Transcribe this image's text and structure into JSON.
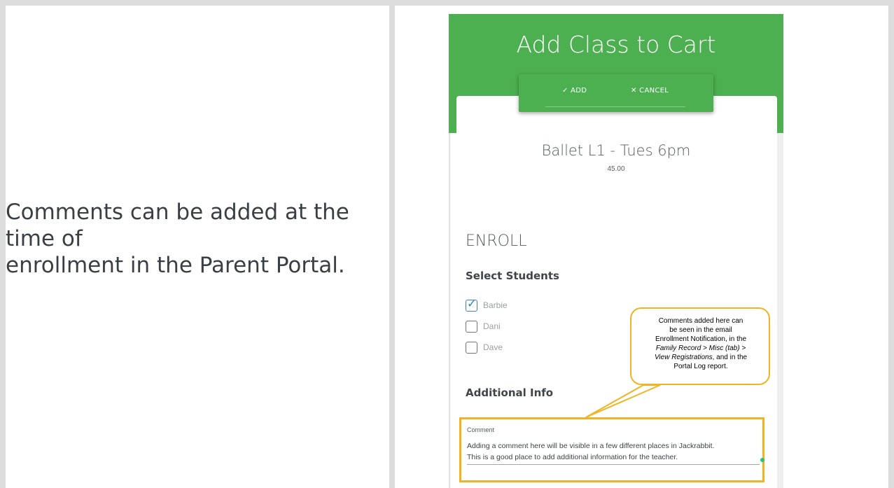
{
  "left_text": {
    "line1": "Comments can be added at the",
    "line2": "time of",
    "line3": "enrollment in the Parent Portal."
  },
  "dialog": {
    "title": "Add Class to Cart",
    "add_label": "✓ ADD",
    "cancel_label": "✕ CANCEL",
    "class_name": "Ballet L1 - Tues 6pm",
    "price": "45.00",
    "enroll_heading": "ENROLL",
    "select_students_heading": "Select Students",
    "students": [
      {
        "name": "Barbie",
        "checked": true
      },
      {
        "name": "Dani",
        "checked": false
      },
      {
        "name": "Dave",
        "checked": false
      }
    ],
    "additional_info_heading": "Additional Info",
    "comment": {
      "label": "Comment",
      "line1": "Adding a comment here will be visible in a few different places in Jackrabbit.",
      "line2": "This is a good place to add additional information for the teacher."
    }
  },
  "callout": {
    "line1": "Comments added here can",
    "line2": "be seen in the email",
    "line3": "Enrollment Notification, in the",
    "line4": "Family Record > Misc (tab) >",
    "line5": "View Registrations",
    "line5_suffix": ", and in the",
    "line6": "Portal Log report."
  },
  "colors": {
    "header_green": "#4caf50",
    "highlight_gold": "#f0b323",
    "check_blue": "#1e88c7"
  }
}
